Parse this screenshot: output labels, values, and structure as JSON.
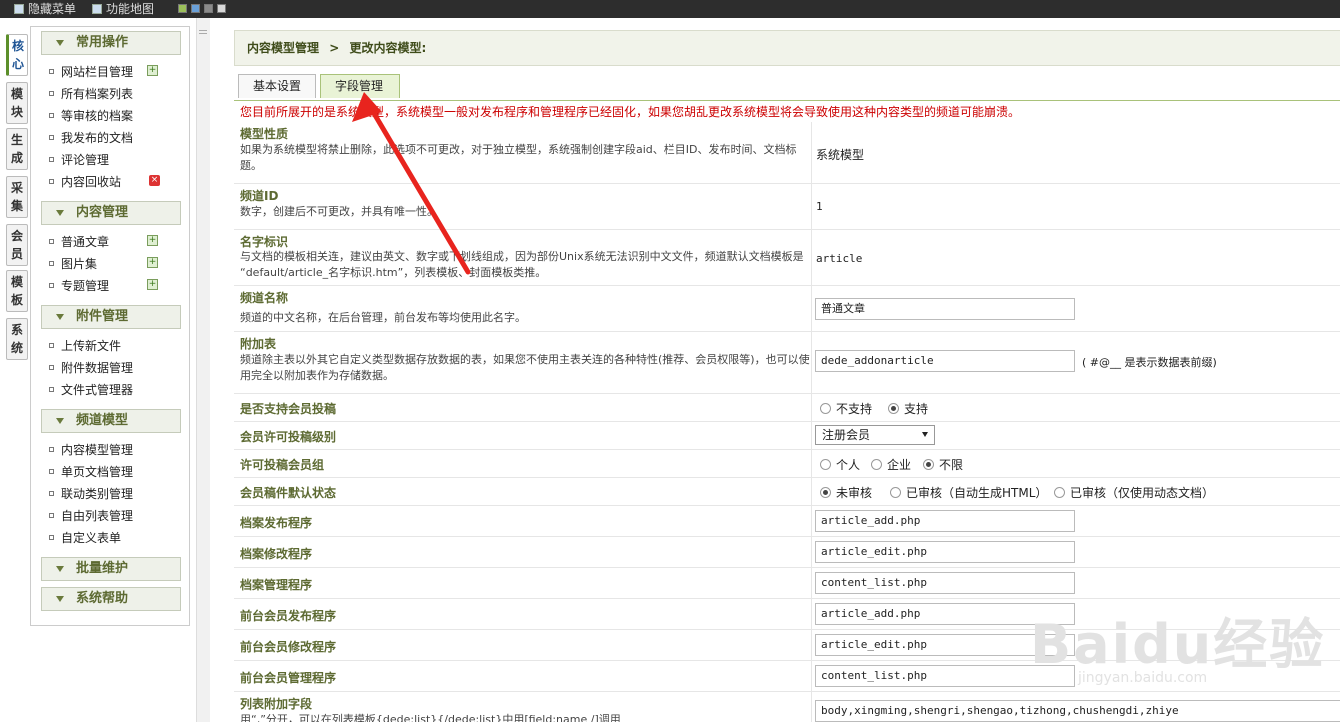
{
  "topbar": {
    "hide_menu": "隐藏菜单",
    "feature_map": "功能地图",
    "skins": [
      "#9bbf5a",
      "#6aa0d8",
      "#8b8b8b",
      "#d8d8d8"
    ]
  },
  "side_tabs": [
    "核心",
    "模块",
    "生成",
    "采集",
    "会员",
    "模板",
    "系统"
  ],
  "menu": {
    "groups": [
      {
        "title": "常用操作",
        "items": [
          {
            "label": "网站栏目管理",
            "icon": "add-icon"
          },
          {
            "label": "所有档案列表",
            "icon": ""
          },
          {
            "label": "等审核的档案",
            "icon": ""
          },
          {
            "label": "我发布的文档",
            "icon": ""
          },
          {
            "label": "评论管理",
            "icon": ""
          },
          {
            "label": "内容回收站",
            "icon": "delete-icon"
          }
        ]
      },
      {
        "title": "内容管理",
        "items": [
          {
            "label": "普通文章",
            "icon": "add-icon"
          },
          {
            "label": "图片集",
            "icon": "add-icon"
          },
          {
            "label": "专题管理",
            "icon": "add-icon"
          }
        ]
      },
      {
        "title": "附件管理",
        "items": [
          {
            "label": "上传新文件",
            "icon": ""
          },
          {
            "label": "附件数据管理",
            "icon": ""
          },
          {
            "label": "文件式管理器",
            "icon": ""
          }
        ]
      },
      {
        "title": "频道模型",
        "items": [
          {
            "label": "内容模型管理",
            "icon": ""
          },
          {
            "label": "单页文档管理",
            "icon": ""
          },
          {
            "label": "联动类别管理",
            "icon": ""
          },
          {
            "label": "自由列表管理",
            "icon": ""
          },
          {
            "label": "自定义表单",
            "icon": ""
          }
        ]
      },
      {
        "title": "批量维护",
        "items": []
      },
      {
        "title": "系统帮助",
        "items": []
      }
    ]
  },
  "breadcrumb": {
    "root": "内容模型管理",
    "sep": ">",
    "current": "更改内容模型:"
  },
  "tabs": [
    "基本设置",
    "字段管理"
  ],
  "warning": "您目前所展开的是系统模型，系统模型一般对发布程序和管理程序已经固化，如果您胡乱更改系统模型将会导致使用这种内容类型的频道可能崩溃。",
  "rows": {
    "nature": {
      "label": "模型性质",
      "desc": "如果为系统模型将禁止删除，此选项不可更改，对于独立模型，系统强制创建字段aid、栏目ID、发布时间、文档标题。",
      "value": "系统模型"
    },
    "channel_id": {
      "label": "频道ID",
      "desc": "数字，创建后不可更改，并具有唯一性。",
      "value": "1"
    },
    "name_id": {
      "label": "名字标识",
      "desc": "与文档的模板相关连，建议由英文、数字或下划线组成，因为部份Unix系统无法识别中文文件，频道默认文档模板是 “default/article_名字标识.htm”，列表模板、封面模板类推。",
      "value": "article"
    },
    "channel_name": {
      "label": "频道名称",
      "desc": "频道的中文名称，在后台管理，前台发布等均使用此名字。",
      "value": "普通文章"
    },
    "addon_table": {
      "label": "附加表",
      "desc": "频道除主表以外其它自定义类型数据存放数据的表，如果您不使用主表关连的各种特性(推荐、会员权限等)，也可以使用完全以附加表作为存储数据。",
      "value": "dede_addonarticle",
      "note": "( #@__ 是表示数据表前缀)"
    },
    "member_submit": {
      "label": "是否支持会员投稿",
      "options": [
        "不支持",
        "支持"
      ],
      "selected": "支持"
    },
    "member_level": {
      "label": "会员许可投稿级别",
      "value": "注册会员"
    },
    "member_group": {
      "label": "许可投稿会员组",
      "options": [
        "个人",
        "企业",
        "不限"
      ],
      "selected": "不限"
    },
    "default_status": {
      "label": "会员稿件默认状态",
      "options": [
        "未审核",
        "已审核（自动生成HTML）",
        "已审核（仅使用动态文档）"
      ],
      "selected": "未审核"
    },
    "add_program": {
      "label": "档案发布程序",
      "value": "article_add.php"
    },
    "edit_program": {
      "label": "档案修改程序",
      "value": "article_edit.php"
    },
    "manage_program": {
      "label": "档案管理程序",
      "value": "content_list.php"
    },
    "front_add": {
      "label": "前台会员发布程序",
      "value": "article_add.php"
    },
    "front_edit": {
      "label": "前台会员修改程序",
      "value": "article_edit.php"
    },
    "front_manage": {
      "label": "前台会员管理程序",
      "value": "content_list.php"
    },
    "list_fields": {
      "label": "列表附加字段",
      "desc": "用“,”分开，可以在列表模板{dede:list}{/dede:list}中用[field:name /]调用",
      "value": "body,xingming,shengri,shengao,tizhong,chushengdi,zhiye"
    }
  },
  "watermark": {
    "brand": "Baidu经验",
    "url": "jingyan.baidu.com"
  }
}
